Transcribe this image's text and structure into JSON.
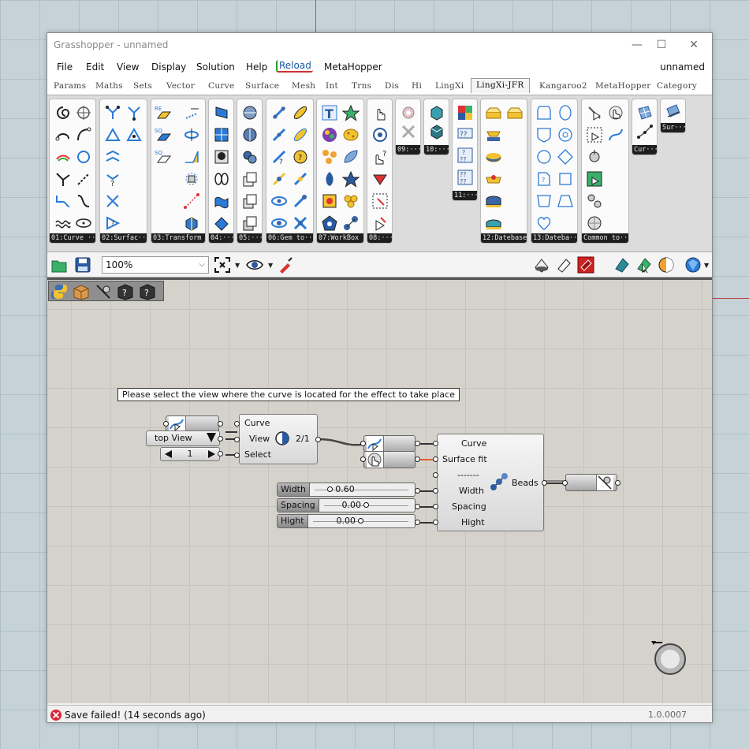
{
  "window": {
    "title": "Grasshopper - unnamed",
    "document_name": "unnamed"
  },
  "menu": [
    "File",
    "Edit",
    "View",
    "Display",
    "Solution",
    "Help",
    "Reload",
    "MetaHopper"
  ],
  "tabs": [
    "Params",
    "Maths",
    "Sets",
    "Vector",
    "Curve",
    "Surface",
    "Mesh",
    "Int",
    "Trns",
    "Dis",
    "Hi",
    "LingXi",
    "LingXi-JFR",
    "Kangaroo2",
    "MetaHopper",
    "Category"
  ],
  "active_tab": "LingXi-JFR",
  "panels": [
    {
      "label": "01:Curve ···"
    },
    {
      "label": "02:Surfac···"
    },
    {
      "label": "03:Transform"
    },
    {
      "label": "04:···"
    },
    {
      "label": "05:···"
    },
    {
      "label": "06:Gem to···"
    },
    {
      "label": "07:WorkBox"
    },
    {
      "label": "08:···"
    },
    {
      "label": "09:···"
    },
    {
      "label": "10:···"
    },
    {
      "label": "11:···"
    },
    {
      "label": "12:Datebase"
    },
    {
      "label": "13:Dateba···"
    },
    {
      "label": "Common to···"
    },
    {
      "label": "Cur···"
    },
    {
      "label": "Sur···"
    }
  ],
  "toolbar": {
    "zoom": "100%"
  },
  "canvas": {
    "tooltip": "Please select the view where the curve is located for the effect to take place",
    "view_component": {
      "inputs": [
        "Curve",
        "View",
        "Select"
      ],
      "counter": "2/1"
    },
    "view_dropdown": "top View",
    "select_stepper": "1",
    "beads_component": {
      "inputs": [
        "Curve",
        "Surface fit",
        "-------",
        "Width",
        "Spacing",
        "Hight"
      ],
      "output": "Beads"
    },
    "sliders": [
      {
        "name": "Width",
        "value": "0.60",
        "fraction": 0.17
      },
      {
        "name": "Spacing",
        "value": "0.00",
        "fraction": 0.5
      },
      {
        "name": "Hight",
        "value": "0.00",
        "fraction": 0.5
      }
    ]
  },
  "status": {
    "message": "Save failed! (14 seconds ago)",
    "version": "1.0.0007"
  },
  "colors": {
    "canvas": "#d4d2cb",
    "wire_highlight": "#e06030",
    "error": "#dd2233"
  }
}
